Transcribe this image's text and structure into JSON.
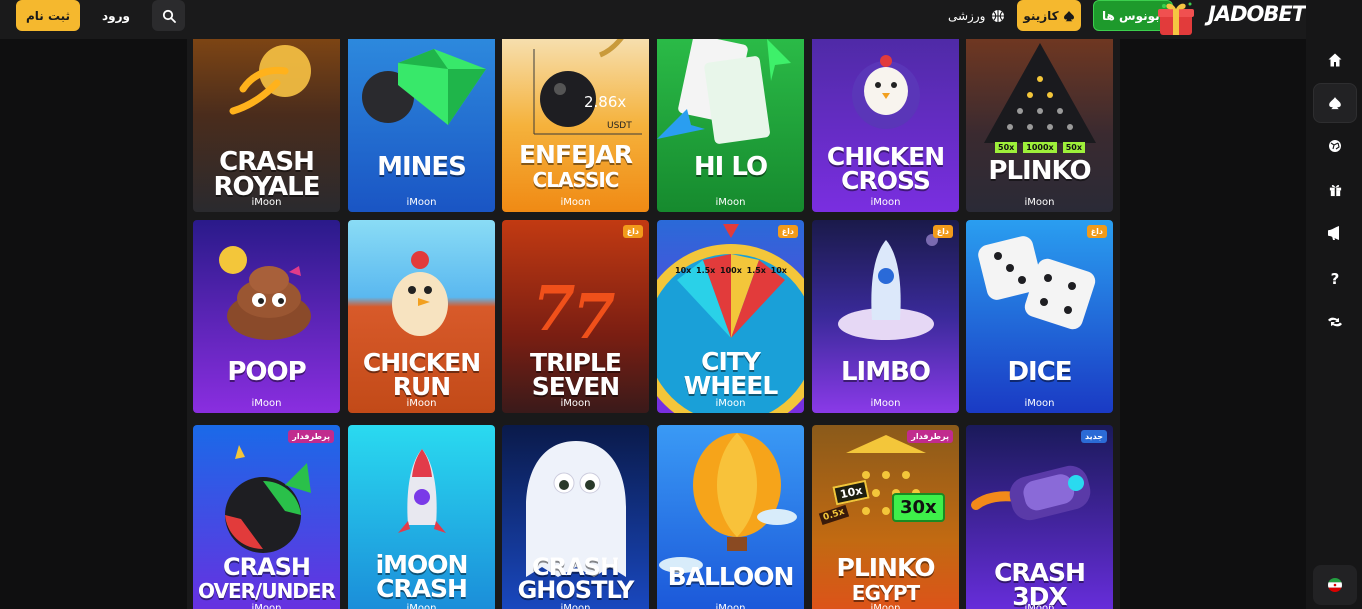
{
  "header": {
    "register_label": "ثبت نام",
    "login_label": "ورود",
    "sports_label": "ورزشی",
    "casino_label": "کازینو",
    "bonus_label": "بونوس ها",
    "logo_text": "JADOBET"
  },
  "sidebar": {
    "items": [
      {
        "name": "home-icon"
      },
      {
        "name": "spade-icon"
      },
      {
        "name": "sports-ball-icon"
      },
      {
        "name": "gift-icon"
      },
      {
        "name": "megaphone-icon"
      },
      {
        "name": "help-icon"
      },
      {
        "name": "exchange-icon"
      }
    ],
    "flag": "iran-flag-icon"
  },
  "games": [
    {
      "title_lines": [
        "CRASH",
        "ROYALE"
      ],
      "provider": "iMoon",
      "badge": ""
    },
    {
      "title_lines": [
        "MINES"
      ],
      "provider": "iMoon",
      "badge": ""
    },
    {
      "title_lines": [
        "ENFEJAR",
        "CLASSIC"
      ],
      "provider": "iMoon",
      "badge": "",
      "overlay_value": "2.86x",
      "overlay_unit": "USDT"
    },
    {
      "title_lines": [
        "HI LO"
      ],
      "provider": "iMoon",
      "badge": ""
    },
    {
      "title_lines": [
        "CHICKEN",
        "CROSS"
      ],
      "provider": "iMoon",
      "badge": ""
    },
    {
      "title_lines": [
        "PLINKO"
      ],
      "provider": "iMoon",
      "badge": "",
      "multipliers": [
        "50x",
        "1000x",
        "50x"
      ]
    },
    {
      "title_lines": [
        "POOP"
      ],
      "provider": "iMoon",
      "badge": ""
    },
    {
      "title_lines": [
        "CHICKEN",
        "RUN"
      ],
      "provider": "iMoon",
      "badge": ""
    },
    {
      "title_lines": [
        "TRIPLE",
        "SEVEN"
      ],
      "provider": "iMoon",
      "badge": "داغ"
    },
    {
      "title_lines": [
        "CITY",
        "WHEEL"
      ],
      "provider": "iMoon",
      "badge": "داغ",
      "wheel_values": [
        "10x",
        "1.5x",
        "100x",
        "1.5x",
        "10x"
      ]
    },
    {
      "title_lines": [
        "LIMBO"
      ],
      "provider": "iMoon",
      "badge": "داغ"
    },
    {
      "title_lines": [
        "DICE"
      ],
      "provider": "iMoon",
      "badge": "داغ"
    },
    {
      "title_lines": [
        "CRASH",
        "OVER/UNDER"
      ],
      "provider": "iMoon",
      "badge": "پرطرفدار"
    },
    {
      "title_lines": [
        "iMOON",
        "CRASH"
      ],
      "provider": "iMoon",
      "badge": ""
    },
    {
      "title_lines": [
        "CRASH",
        "GHOSTLY"
      ],
      "provider": "iMoon",
      "badge": ""
    },
    {
      "title_lines": [
        "BALLOON"
      ],
      "provider": "iMoon",
      "badge": ""
    },
    {
      "title_lines": [
        "PLINKO",
        "EGYPT"
      ],
      "provider": "iMoon",
      "badge": "پرطرفدار",
      "multipliers": [
        "10x",
        "30x",
        "0.5x"
      ]
    },
    {
      "title_lines": [
        "CRASH",
        "3DX"
      ],
      "provider": "iMoon",
      "badge": "جدید"
    }
  ],
  "colors": {
    "accent_yellow": "#f5b82e",
    "bonus_green": "#1e9a2c",
    "badge_hot": "#f29b1b",
    "badge_popular": "#c12b8e",
    "badge_new": "#2b6bd6"
  }
}
